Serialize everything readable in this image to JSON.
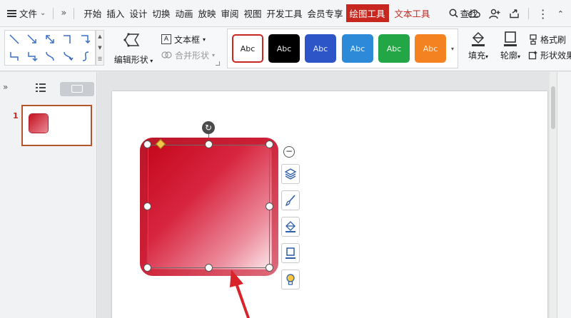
{
  "menubar": {
    "file_label": "文件",
    "tabs": [
      "开始",
      "插入",
      "设计",
      "切换",
      "动画",
      "放映",
      "审阅",
      "视图",
      "开发工具",
      "会员专享"
    ],
    "active_tab": "绘图工具",
    "text_tool_tab": "文本工具",
    "search_label": "查找"
  },
  "ribbon": {
    "edit_shape_label": "编辑形状",
    "textbox_label": "文本框",
    "merge_shape_label": "合并形状",
    "style_buttons": [
      {
        "label": "Abc",
        "bg": "#ffffff",
        "fg": "#222222",
        "border": "#c7271e"
      },
      {
        "label": "Abc",
        "bg": "#000000",
        "fg": "#e6e6e6",
        "border": "#000000"
      },
      {
        "label": "Abc",
        "bg": "#2d55c7",
        "fg": "#e6ecff",
        "border": "#2d55c7"
      },
      {
        "label": "Abc",
        "bg": "#2d8ad8",
        "fg": "#e6f2ff",
        "border": "#2d8ad8"
      },
      {
        "label": "Abc",
        "bg": "#23a645",
        "fg": "#e6ffe9",
        "border": "#23a645"
      },
      {
        "label": "Abc",
        "bg": "#f58220",
        "fg": "#fff1e2",
        "border": "#f58220"
      }
    ],
    "fill_label": "填充",
    "outline_label": "轮廓",
    "format_brush_label": "格式刷",
    "shape_effect_label": "形状效果"
  },
  "leftpanel": {
    "slide_number": "1"
  },
  "colors": {
    "accent": "#c7271e",
    "shape_dark": "#c4071c",
    "shape_light": "#fbe7ea"
  }
}
